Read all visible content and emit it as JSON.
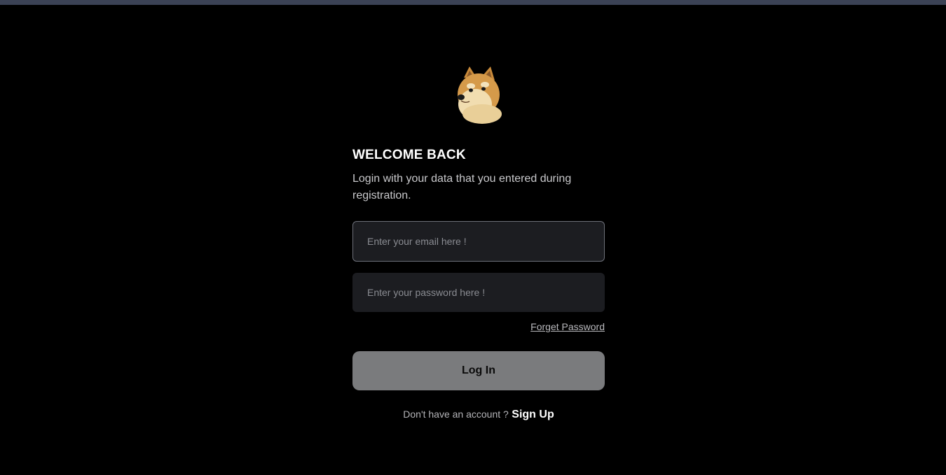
{
  "login": {
    "title": "WELCOME BACK",
    "subtitle": "Login with your data that you entered during registration.",
    "email_placeholder": "Enter your email here !",
    "email_value": "",
    "password_placeholder": "Enter your password here !",
    "password_value": "",
    "forgot_label": "Forget Password",
    "login_button_label": "Log In",
    "signup_prompt": "Don't have an account ?",
    "signup_link_label": "Sign Up"
  },
  "icons": {
    "logo": "doge-logo-icon"
  },
  "colors": {
    "background": "#000000",
    "top_bar": "#3b4255",
    "input_background": "#1c1d21",
    "input_border_focused": "#6d7079",
    "button_background": "#7a7b7d",
    "heading_text": "#ffffff",
    "muted_text": "#b4b4b8"
  }
}
